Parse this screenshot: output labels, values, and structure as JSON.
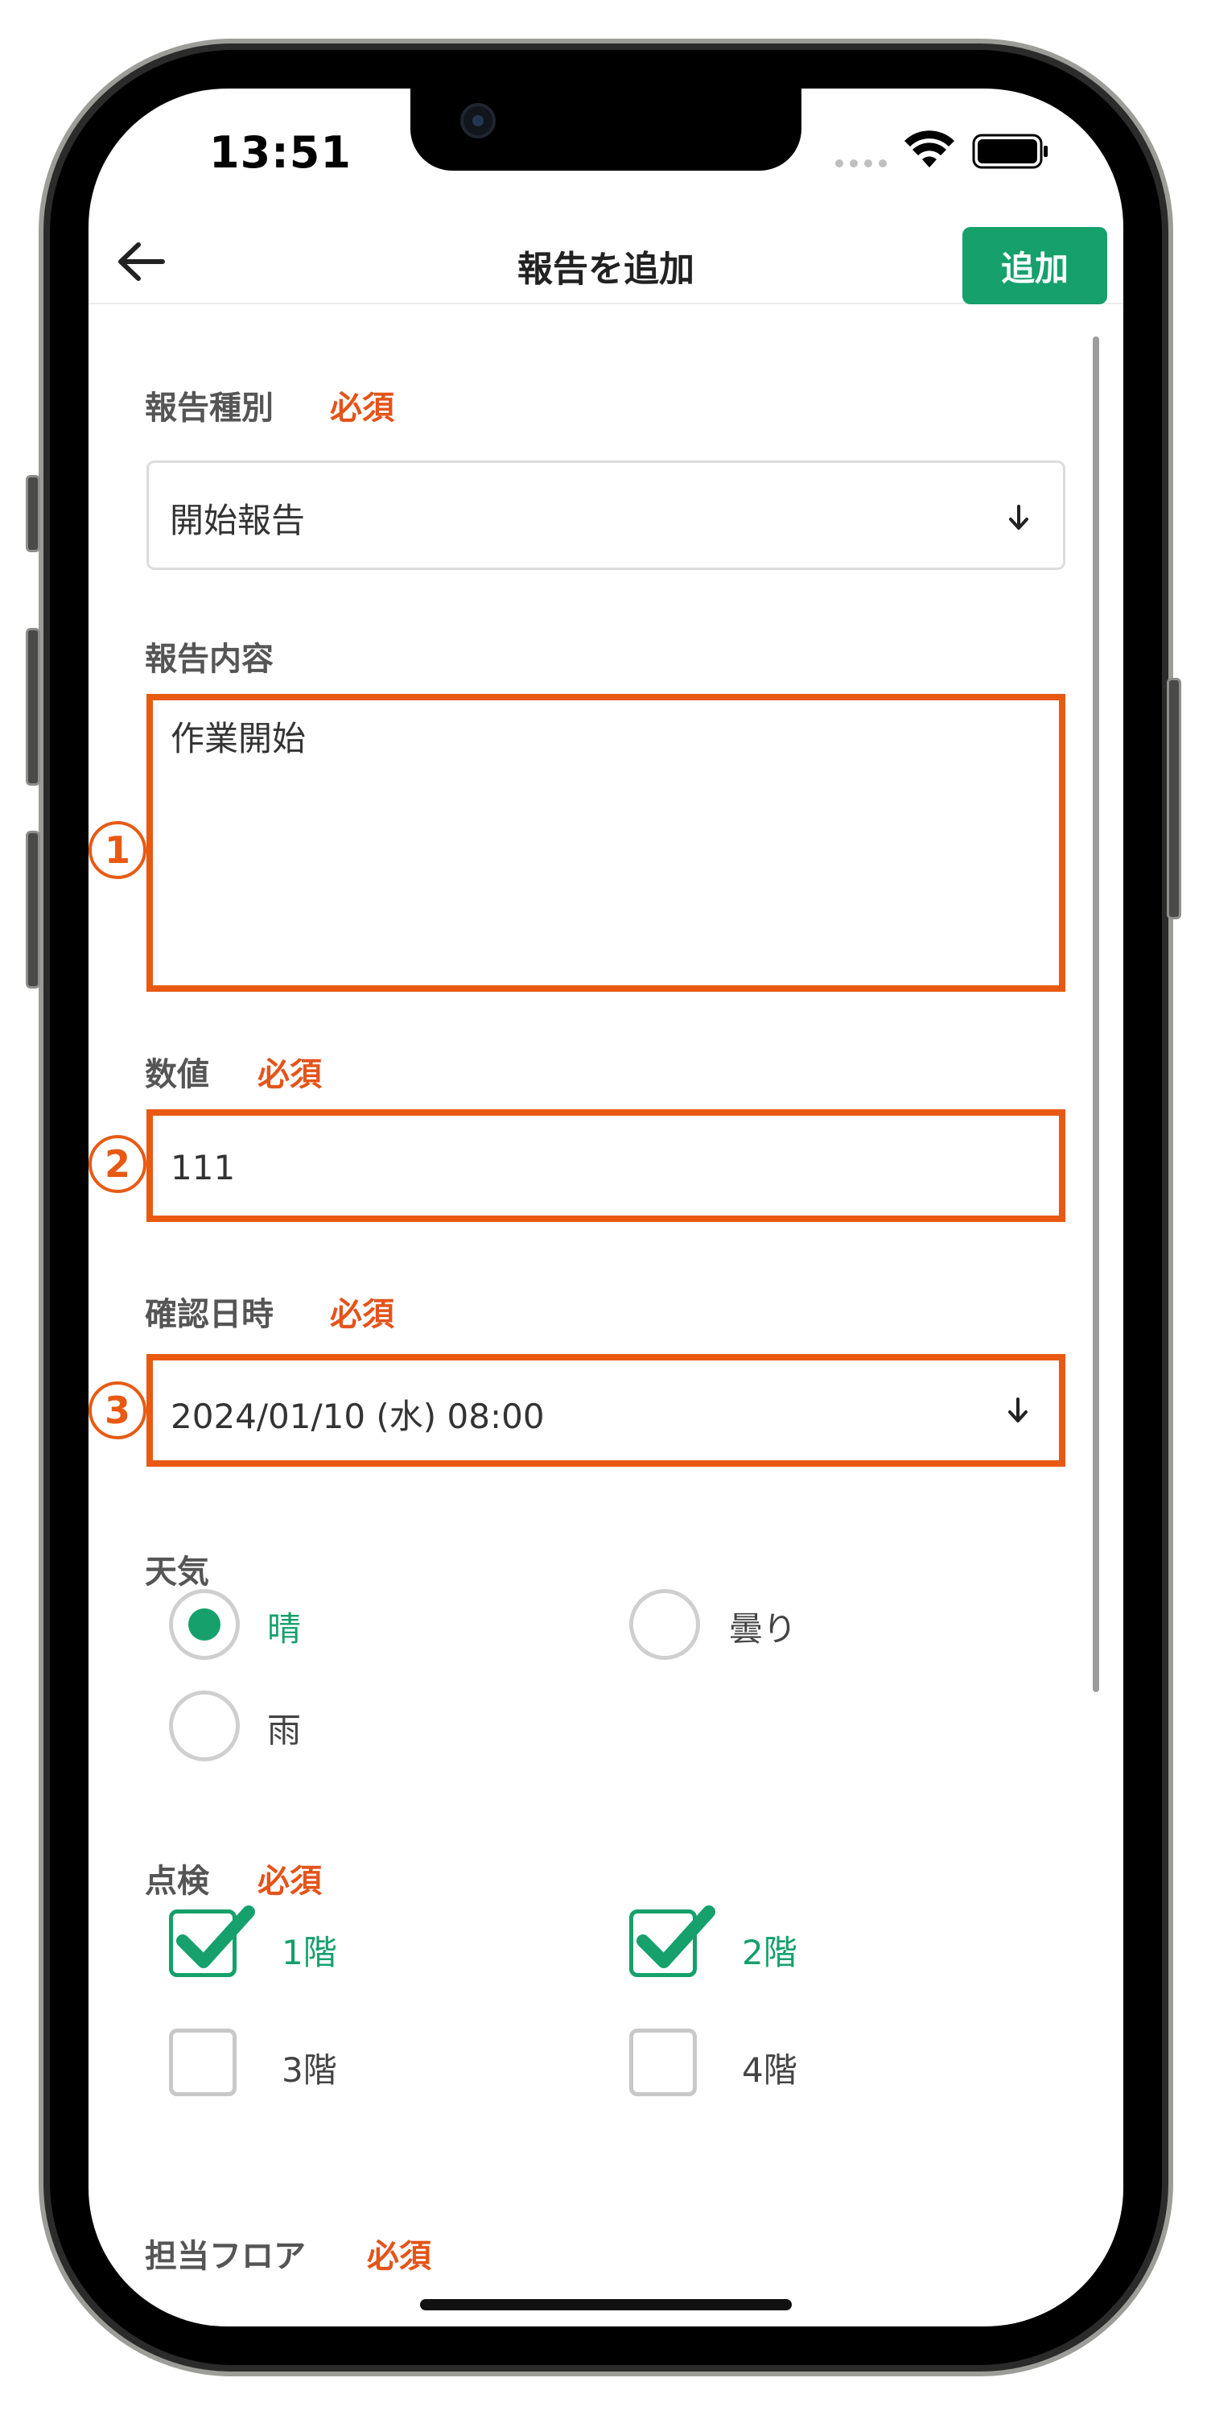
{
  "status_bar": {
    "time": "13:51"
  },
  "nav": {
    "title": "報告を追加",
    "add_label": "追加"
  },
  "form": {
    "report_type": {
      "label": "報告種別",
      "required": "必須",
      "value": "開始報告"
    },
    "report_content": {
      "label": "報告内容",
      "value": "作業開始",
      "callout": "1"
    },
    "number_value": {
      "label": "数値",
      "required": "必須",
      "value": "111",
      "callout": "2"
    },
    "confirm_datetime": {
      "label": "確認日時",
      "required": "必須",
      "value": "2024/01/10 (水) 08:00",
      "callout": "3"
    },
    "weather": {
      "label": "天気",
      "options": [
        {
          "label": "晴",
          "selected": true
        },
        {
          "label": "曇り",
          "selected": false
        },
        {
          "label": "雨",
          "selected": false
        }
      ]
    },
    "inspection": {
      "label": "点検",
      "required": "必須",
      "options": [
        {
          "label": "1階",
          "checked": true
        },
        {
          "label": "2階",
          "checked": true
        },
        {
          "label": "3階",
          "checked": false
        },
        {
          "label": "4階",
          "checked": false
        }
      ]
    },
    "floor": {
      "label": "担当フロア",
      "required": "必須"
    }
  },
  "colors": {
    "accent": "#16a06b",
    "required": "#e4541a",
    "highlight": "#e85a13"
  }
}
